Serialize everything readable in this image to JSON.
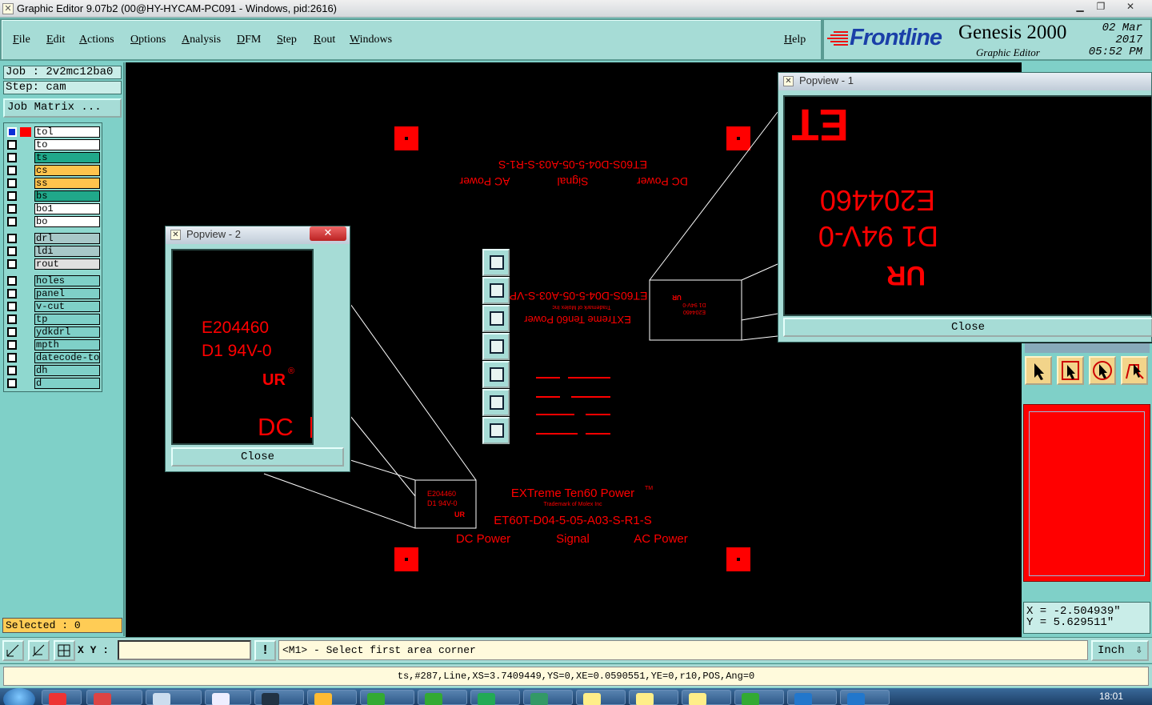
{
  "window": {
    "title": "Graphic Editor 9.07b2 (00@HY-HYCAM-PC091 - Windows, pid:2616)"
  },
  "menu": [
    "File",
    "Edit",
    "Actions",
    "Options",
    "Analysis",
    "DFM",
    "Step",
    "Rout",
    "Windows"
  ],
  "help": "Help",
  "brand": {
    "logo": "Frontline",
    "product": "Genesis 2000",
    "subtitle": "Graphic Editor",
    "date": "02 Mar 2017",
    "time": "05:52 PM"
  },
  "job": {
    "job_line": "Job : 2v2mc12ba0",
    "step_line": "Step: cam",
    "matrix_button": "Job Matrix ..."
  },
  "layers": [
    {
      "name": "tol",
      "color": "#ffffff"
    },
    {
      "name": "to",
      "color": "#ffffff"
    },
    {
      "name": "ts",
      "color": "#20a88a"
    },
    {
      "name": "cs",
      "color": "#ffc34d"
    },
    {
      "name": "ss",
      "color": "#ffc34d"
    },
    {
      "name": "bs",
      "color": "#20a88a"
    },
    {
      "name": "bo1",
      "color": "#ffffff"
    },
    {
      "name": "bo",
      "color": "#ffffff"
    },
    {
      "name": "drl",
      "color": "#a8c8c8"
    },
    {
      "name": "ldi",
      "color": "#a8c8c8"
    },
    {
      "name": "rout",
      "color": "#e0e0e0"
    },
    {
      "name": "holes",
      "color": "#7fd0c8"
    },
    {
      "name": "panel",
      "color": "#7fd0c8"
    },
    {
      "name": "v-cut",
      "color": "#7fd0c8"
    },
    {
      "name": "tp",
      "color": "#7fd0c8"
    },
    {
      "name": "ydkdrl",
      "color": "#7fd0c8"
    },
    {
      "name": "mpth",
      "color": "#7fd0c8"
    },
    {
      "name": "datecode-tol",
      "color": "#7fd0c8"
    },
    {
      "name": "dh",
      "color": "#7fd0c8"
    },
    {
      "name": "d",
      "color": "#7fd0c8"
    }
  ],
  "selected": "Selected : 0",
  "board": {
    "accent": "#ff0000",
    "top_texts": {
      "model": "ET60S-D04-5-05-A03-S-R1-S",
      "dc": "DC Power",
      "signal": "Signal",
      "ac": "AC Power"
    },
    "mid_texts": {
      "model": "ET60S-D04-5-05-A03-S-VP-S",
      "brand": "EXTreme Ten60 Power",
      "tm": "TM",
      "trademark": "Trademark of Molex Inc"
    },
    "bottom_texts": {
      "brand": "EXTreme Ten60 Power",
      "tm": "TM",
      "trademark": "Trademark of Molex Inc",
      "model": "ET60T-D04-5-05-A03-S-R1-S",
      "dc": "DC Power",
      "signal": "Signal",
      "ac": "AC Power"
    },
    "small_labels": {
      "code": "E204460",
      "rating": "D1 94V-0"
    }
  },
  "popview2": {
    "title": "Popview - 2",
    "code": "E204460",
    "rating": "D1  94V-0",
    "ul": "UR",
    "dc": "DC",
    "close": "Close"
  },
  "popview1": {
    "title": "Popview - 1",
    "code": "E204460",
    "rating": "D1  94V-0",
    "ul": "UR",
    "et": "ET",
    "close": "Close"
  },
  "coords": {
    "x": "X = -2.504939\"",
    "y": "Y =  5.629511\""
  },
  "cmd": {
    "xy_label": "X Y :",
    "xy_value": "",
    "prompt": "<M1> - Select first area corner",
    "unit": "Inch"
  },
  "status": "ts,#287,Line,XS=3.7409449,YS=0,XE=0.0590551,YE=0,r10,POS,Ang=0",
  "taskbar": {
    "clock": "18:01"
  }
}
